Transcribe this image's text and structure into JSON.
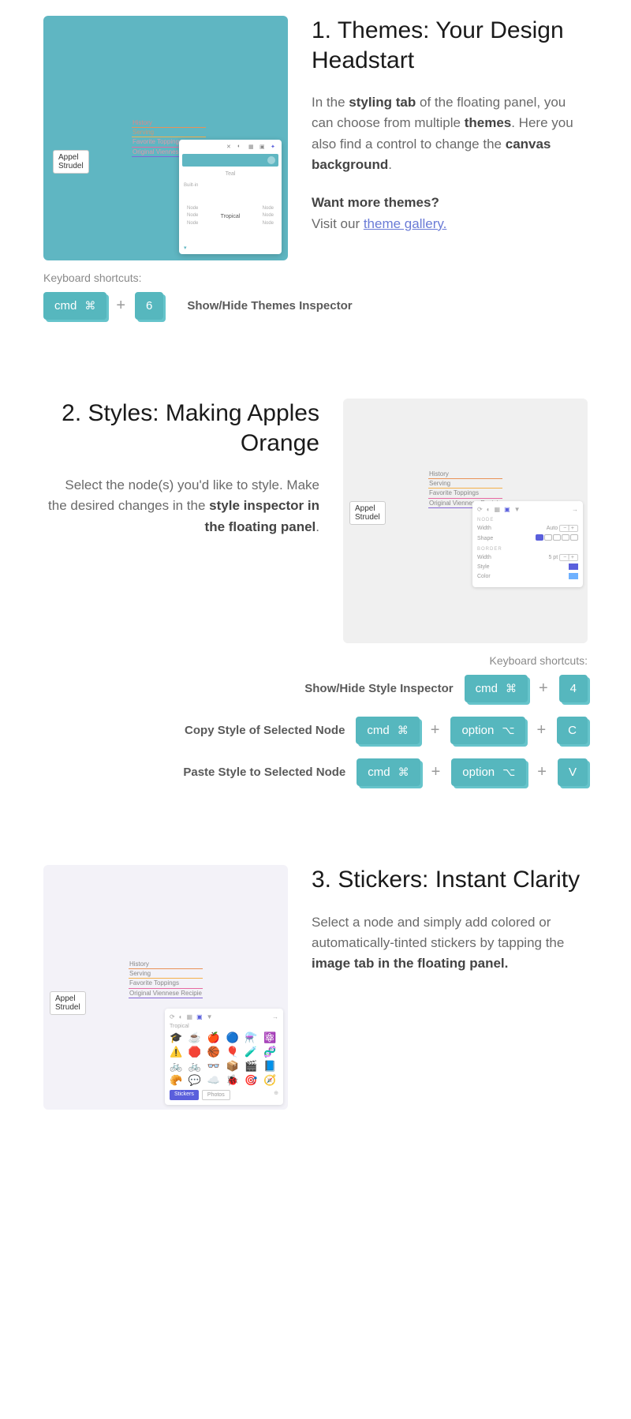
{
  "section1": {
    "title": "1. Themes: Your Design Headstart",
    "para_pre": "In the ",
    "para_b1": "styling tab",
    "para_mid1": " of the floating panel, you can choose from multiple ",
    "para_b2": "themes",
    "para_mid2": ". Here you also find a control to change the ",
    "para_b3": "canvas background",
    "para_end": ".",
    "want": "Want more themes?",
    "visit_pre": "Visit our ",
    "visit_link": "theme gallery.",
    "kbd_label": "Keyboard shortcuts:",
    "shortcut_desc": "Show/Hide Themes Inspector",
    "keys": {
      "cmd": "cmd",
      "cmd_sym": "⌘",
      "plus": "+",
      "six": "6"
    }
  },
  "mindmap": {
    "root": "Appel Strudel",
    "kids": [
      "History",
      "Serving",
      "Favorite Toppings",
      "Original Viennese Recipie"
    ]
  },
  "panel1": {
    "teal_label": "Teal",
    "builtin": "Built-in",
    "center": "Tropical",
    "side": "Node"
  },
  "section2": {
    "title": "2. Styles: Making Apples Orange",
    "para_pre": "Select the node(s) you'd like to style. Make the desired changes in the ",
    "para_b1": "style inspector in the floating panel",
    "para_end": ".",
    "kbd_label": "Keyboard shortcuts:",
    "rows": [
      {
        "lbl": "Show/Hide Style Inspector",
        "k": [
          "cmd",
          "4"
        ]
      },
      {
        "lbl": "Copy Style of Selected Node",
        "k": [
          "cmd",
          "option",
          "C"
        ]
      },
      {
        "lbl": "Paste Style to Selected Node",
        "k": [
          "cmd",
          "option",
          "V"
        ]
      }
    ],
    "keys": {
      "cmd": "cmd",
      "cmd_sym": "⌘",
      "option": "option",
      "option_sym": "⌥",
      "plus": "+",
      "four": "4",
      "c": "C",
      "v": "V"
    }
  },
  "panel2": {
    "node_hdr": "NODE",
    "width": "Width",
    "auto": "Auto",
    "shape": "Shape",
    "border_hdr": "BORDER",
    "bwidth": "Width",
    "bval": "5 pt",
    "style": "Style",
    "color": "Color"
  },
  "section3": {
    "title": "3. Stickers: Instant Clarity",
    "para_pre": "Select a node and simply add colored or automatically-tinted stickers by tapping the ",
    "para_b1": "image tab in the floating panel.",
    "panel_label": "Tropical",
    "btn1": "Stickers",
    "btn2": "Photos"
  }
}
